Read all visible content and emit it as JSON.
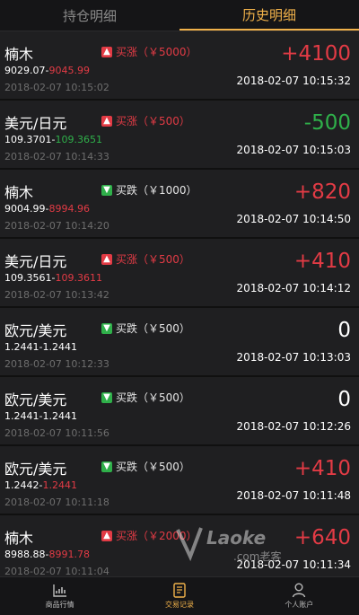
{
  "tabs": [
    {
      "label": "持仓明细",
      "active": false
    },
    {
      "label": "历史明细",
      "active": true
    }
  ],
  "records": [
    {
      "name": "楠木",
      "dir": "up",
      "badge": "买涨（￥5000）",
      "open": "9029.07",
      "close": "9045.99",
      "close_color": "red",
      "open_time": "2018-02-07 10:15:02",
      "profit": "+4100",
      "profit_color": "red",
      "close_time": "2018-02-07 10:15:32"
    },
    {
      "name": "美元/日元",
      "dir": "up",
      "badge": "买涨（￥500）",
      "open": "109.3701",
      "close": "109.3651",
      "close_color": "green",
      "open_time": "2018-02-07 10:14:33",
      "profit": "-500",
      "profit_color": "green",
      "close_time": "2018-02-07 10:15:03"
    },
    {
      "name": "楠木",
      "dir": "down",
      "badge": "买跌（￥1000）",
      "open": "9004.99",
      "close": "8994.96",
      "close_color": "red",
      "open_time": "2018-02-07 10:14:20",
      "profit": "+820",
      "profit_color": "red",
      "close_time": "2018-02-07 10:14:50"
    },
    {
      "name": "美元/日元",
      "dir": "up",
      "badge": "买涨（￥500）",
      "open": "109.3561",
      "close": "109.3611",
      "close_color": "red",
      "open_time": "2018-02-07 10:13:42",
      "profit": "+410",
      "profit_color": "red",
      "close_time": "2018-02-07 10:14:12"
    },
    {
      "name": "欧元/美元",
      "dir": "down",
      "badge": "买跌（￥500）",
      "open": "1.2441",
      "close": "1.2441",
      "close_color": "white",
      "open_time": "2018-02-07 10:12:33",
      "profit": "0",
      "profit_color": "white",
      "close_time": "2018-02-07 10:13:03"
    },
    {
      "name": "欧元/美元",
      "dir": "down",
      "badge": "买跌（￥500）",
      "open": "1.2441",
      "close": "1.2441",
      "close_color": "white",
      "open_time": "2018-02-07 10:11:56",
      "profit": "0",
      "profit_color": "white",
      "close_time": "2018-02-07 10:12:26"
    },
    {
      "name": "欧元/美元",
      "dir": "down",
      "badge": "买跌（￥500）",
      "open": "1.2442",
      "close": "1.2441",
      "close_color": "red",
      "open_time": "2018-02-07 10:11:18",
      "profit": "+410",
      "profit_color": "red",
      "close_time": "2018-02-07 10:11:48"
    },
    {
      "name": "楠木",
      "dir": "up",
      "badge": "买涨（￥2000）",
      "open": "8988.88",
      "close": "8991.78",
      "close_color": "red",
      "open_time": "2018-02-07 10:11:04",
      "profit": "+640",
      "profit_color": "red",
      "close_time": "2018-02-07 10:11:34"
    }
  ],
  "nav": [
    {
      "label": "商品行情",
      "icon": "chart-icon",
      "active": false
    },
    {
      "label": "交易记录",
      "icon": "document-icon",
      "active": true
    },
    {
      "label": "个人账户",
      "icon": "user-icon",
      "active": false
    }
  ],
  "watermark": {
    "text": "Laoke",
    "sub": ".com老客"
  },
  "colors": {
    "accent": "#f0b14a",
    "up": "#e23b45",
    "down": "#2fb04a",
    "bg": "#1f1f21"
  }
}
